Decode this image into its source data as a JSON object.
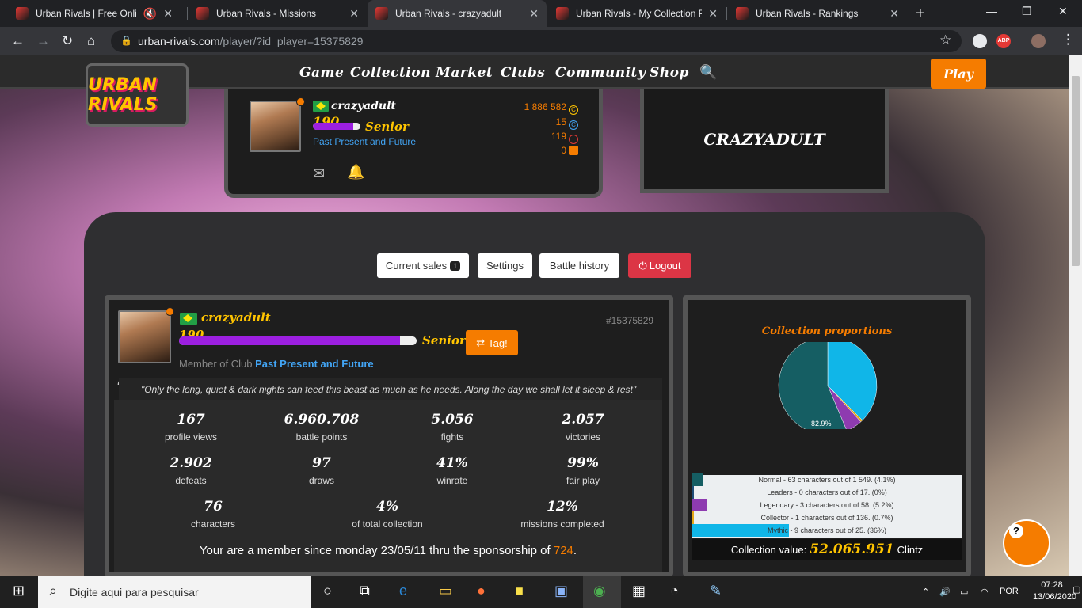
{
  "browser": {
    "tabs": [
      {
        "title": "Urban Rivals | Free Online"
      },
      {
        "title": "Urban Rivals - Missions"
      },
      {
        "title": "Urban Rivals - crazyadult"
      },
      {
        "title": "Urban Rivals - My Collection P"
      },
      {
        "title": "Urban Rivals - Rankings"
      }
    ],
    "url_host": "urban-rivals.com",
    "url_path": "/player/?id_player=15375829",
    "extension_label": "ABP"
  },
  "site": {
    "logo_text": "URBAN RIVALS",
    "nav": [
      "Game",
      "Collection",
      "Market",
      "Clubs",
      "Community",
      "Shop"
    ],
    "play_label": "Play"
  },
  "user_card": {
    "username": "crazyadult",
    "level": "190",
    "level_progress": 0.85,
    "rank": "Senior",
    "club": "Past Present and Future",
    "clintz": "1 886 582",
    "credits": "15",
    "third_currency": "119",
    "fourth_currency": "0",
    "nameplate": "CRAZYADULT"
  },
  "actions": {
    "current_sales": "Current sales",
    "current_sales_count": "1",
    "settings": "Settings",
    "battle_history": "Battle history",
    "logout": "Logout"
  },
  "profile": {
    "username": "crazyadult",
    "level": "190",
    "level_progress": 0.93,
    "rank": "Senior",
    "player_id": "#15375829",
    "tag_label": "Tag!",
    "member_of_prefix": "Member of Club",
    "club": "Past Present and Future",
    "quote": "\"Only the long, quiet & dark nights can feed this beast as much as he needs. Along the day we shall let it sleep & rest\"",
    "stats": [
      {
        "value": "167",
        "label": "profile views"
      },
      {
        "value": "6.960.708",
        "label": "battle points"
      },
      {
        "value": "5.056",
        "label": "fights"
      },
      {
        "value": "2.057",
        "label": "victories"
      },
      {
        "value": "2.902",
        "label": "defeats"
      },
      {
        "value": "97",
        "label": "draws"
      },
      {
        "value": "41%",
        "label": "winrate"
      },
      {
        "value": "99%",
        "label": "fair play"
      }
    ],
    "stats2": [
      {
        "value": "76",
        "label": "characters"
      },
      {
        "value": "4%",
        "label": "of total collection"
      },
      {
        "value": "12%",
        "label": "missions completed"
      }
    ],
    "member_since_text": "Your are a member since monday 23/05/11 thru the sponsorship of",
    "sponsor": "724",
    "member_since_end": "."
  },
  "collection": {
    "title": "Collection proportions",
    "pie_label": "82.9%",
    "legend": [
      {
        "text": "Normal - 63 characters out of 1 549. (4.1%)",
        "color": "#155e63",
        "fraction": 0.041
      },
      {
        "text": "Leaders - 0 characters out of 17. (0%)",
        "color": "#1f4d78",
        "fraction": 0.0
      },
      {
        "text": "Legendary - 3 characters out of 58. (5.2%)",
        "color": "#8e3bb0",
        "fraction": 0.052
      },
      {
        "text": "Collector - 1 characters out of 136. (0.7%)",
        "color": "#e6a817",
        "fraction": 0.007
      },
      {
        "text": "Mythic - 9 characters out of 25. (36%)",
        "color": "#10b6e8",
        "fraction": 0.36
      }
    ],
    "value_prefix": "Collection value:",
    "value": "52.065.951",
    "value_suffix": "Clintz"
  },
  "chart_data": {
    "type": "pie",
    "title": "Collection proportions",
    "categories": [
      "Normal",
      "Leaders",
      "Legendary",
      "Collector",
      "Mythic"
    ],
    "values": [
      4.1,
      0,
      5.2,
      0.7,
      36
    ]
  },
  "taskbar": {
    "search_placeholder": "Digite aqui para pesquisar",
    "language": "POR",
    "time": "07:28",
    "date": "13/06/2020"
  }
}
